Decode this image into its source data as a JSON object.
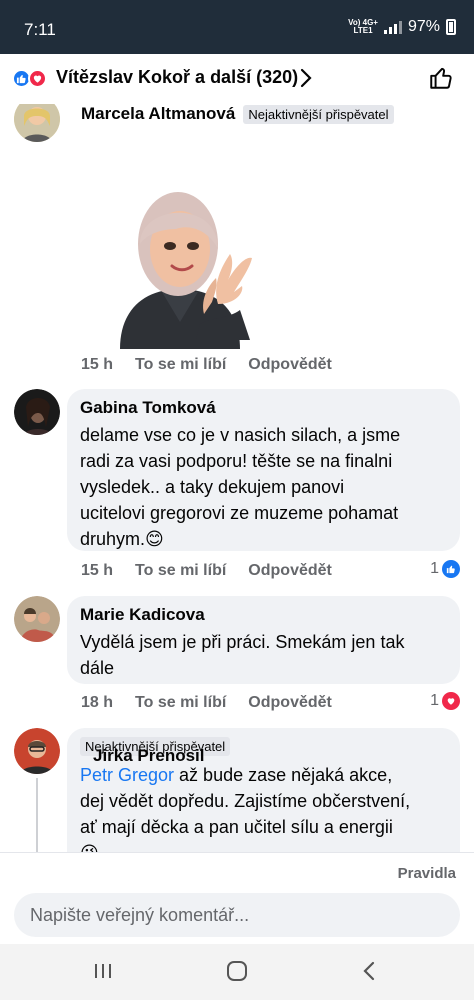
{
  "status_bar": {
    "time": "7:11",
    "net_top": "Vo) 4G+",
    "net_bottom": "LTE1",
    "battery": "97%"
  },
  "header": {
    "title": "Vítězslav Kokoř a další (320)",
    "reaction_icons": [
      "like-icon",
      "love-icon"
    ]
  },
  "comments": [
    {
      "name": "Marcela Altmanová",
      "badge": "Nejaktivnější přispěvatel",
      "sticker": "avatar-clapping-sticker",
      "time": "15 h",
      "like_label": "To se mi líbí",
      "reply_label": "Odpovědět"
    },
    {
      "name": "Gabina Tomková",
      "lines": [
        "delame vse co je v nasich silach, a jsme",
        "radi za vasi podporu! těšte se na finalni",
        "vysledek.. a taky  dekujem panovi",
        "ucitelovi gregorovi ze muzeme pohamat",
        "druhym.😊"
      ],
      "time": "15 h",
      "like_label": "To se mi líbí",
      "reply_label": "Odpovědět",
      "reaction_count": "1",
      "reaction_type": "like"
    },
    {
      "name": "Marie Kadicova",
      "lines": [
        "Vydělá jsem je při práci. Smekám jen tak",
        "dále"
      ],
      "time": "18 h",
      "like_label": "To se mi líbí",
      "reply_label": "Odpovědět",
      "reaction_count": "1",
      "reaction_type": "love"
    },
    {
      "name": "Jirka Prenosil",
      "badge": "Nejaktivnější přispěvatel",
      "mention": "Petr Gregor",
      "line1_rest": " až bude zase nějaká akce,",
      "lines": [
        "dej vědět dopředu. Zajistíme občerstvení,",
        "ať mají děcka a pan učitel sílu a energii",
        "😉"
      ]
    }
  ],
  "footer": {
    "rules": "Pravidla",
    "input_placeholder": "Napište veřejný komentář..."
  },
  "colors": {
    "status_bg": "#202d3a",
    "accent": "#1877f2",
    "love": "#f0284a",
    "bubble": "#f0f2f5",
    "meta": "#65676b"
  }
}
